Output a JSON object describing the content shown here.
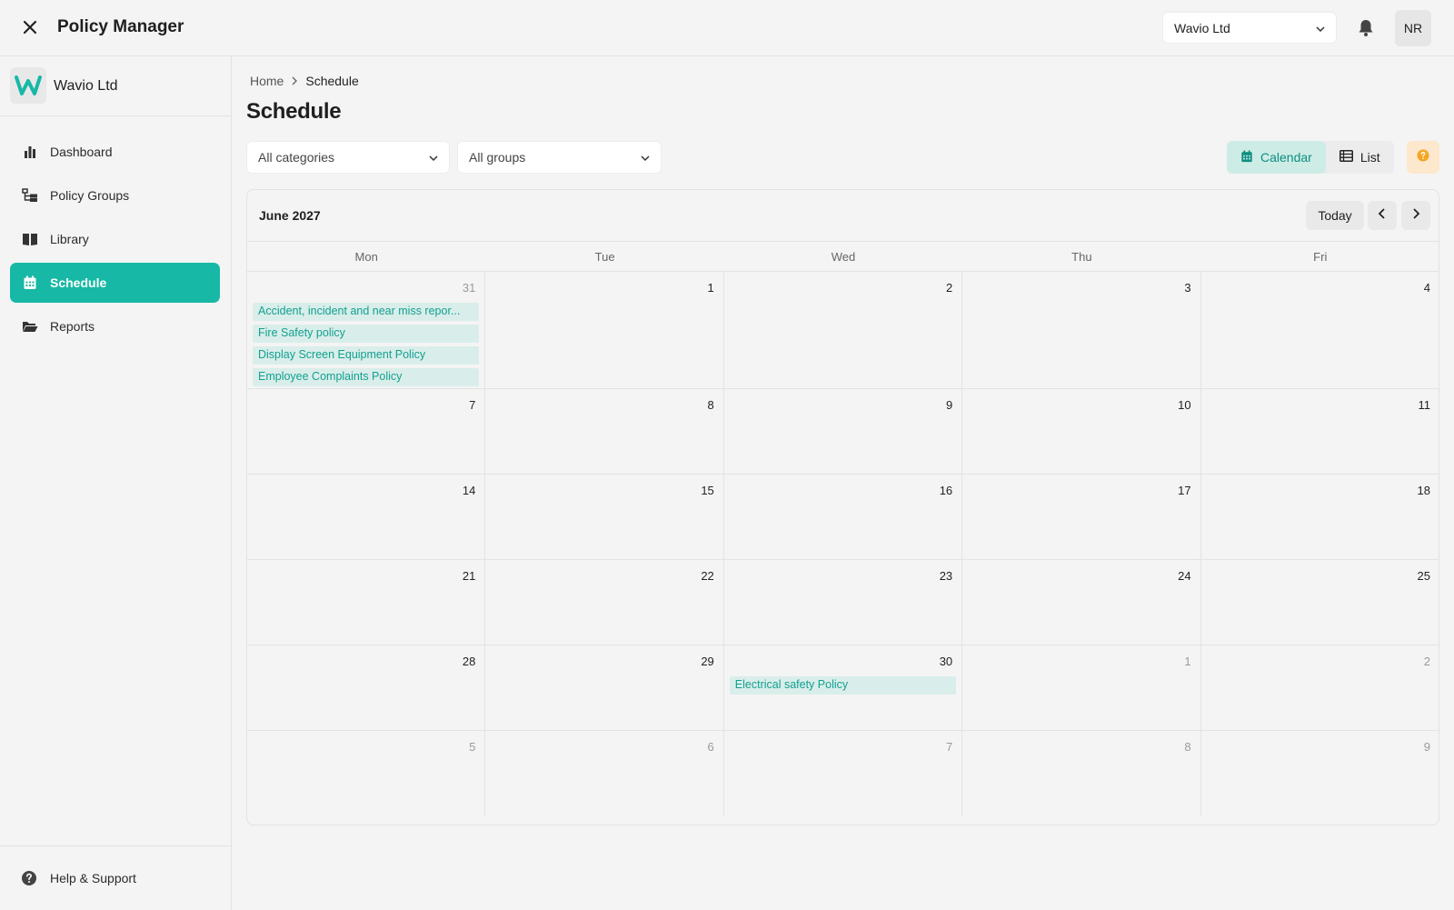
{
  "app": {
    "title": "Policy Manager"
  },
  "header": {
    "org_select": "Wavio Ltd",
    "avatar_initials": "NR"
  },
  "sidebar": {
    "org_name": "Wavio Ltd",
    "items": [
      {
        "label": "Dashboard",
        "icon": "bar-chart-icon"
      },
      {
        "label": "Policy Groups",
        "icon": "hierarchy-icon"
      },
      {
        "label": "Library",
        "icon": "book-icon"
      },
      {
        "label": "Schedule",
        "icon": "calendar-icon",
        "active": true
      },
      {
        "label": "Reports",
        "icon": "folder-icon"
      }
    ],
    "help_label": "Help & Support"
  },
  "breadcrumb": {
    "home": "Home",
    "current": "Schedule"
  },
  "page": {
    "title": "Schedule"
  },
  "filters": {
    "categories": "All categories",
    "groups": "All groups"
  },
  "view_toggle": {
    "calendar": "Calendar",
    "list": "List",
    "active": "Calendar"
  },
  "calendar": {
    "month_label": "June 2027",
    "today_label": "Today",
    "weekdays": [
      "Mon",
      "Tue",
      "Wed",
      "Thu",
      "Fri"
    ],
    "weeks": [
      [
        {
          "day": "31",
          "muted": true,
          "events": [
            "Accident, incident and near miss repor...",
            "Fire Safety policy",
            "Display Screen Equipment Policy",
            "Employee Complaints Policy"
          ]
        },
        {
          "day": "1"
        },
        {
          "day": "2"
        },
        {
          "day": "3"
        },
        {
          "day": "4"
        }
      ],
      [
        {
          "day": "7"
        },
        {
          "day": "8"
        },
        {
          "day": "9"
        },
        {
          "day": "10"
        },
        {
          "day": "11"
        }
      ],
      [
        {
          "day": "14"
        },
        {
          "day": "15"
        },
        {
          "day": "16"
        },
        {
          "day": "17"
        },
        {
          "day": "18"
        }
      ],
      [
        {
          "day": "21"
        },
        {
          "day": "22"
        },
        {
          "day": "23"
        },
        {
          "day": "24"
        },
        {
          "day": "25"
        }
      ],
      [
        {
          "day": "28"
        },
        {
          "day": "29"
        },
        {
          "day": "30",
          "events": [
            "Electrical safety Policy"
          ]
        },
        {
          "day": "1",
          "muted": true
        },
        {
          "day": "2",
          "muted": true
        }
      ],
      [
        {
          "day": "5",
          "muted": true
        },
        {
          "day": "6",
          "muted": true
        },
        {
          "day": "7",
          "muted": true
        },
        {
          "day": "8",
          "muted": true
        },
        {
          "day": "9",
          "muted": true
        }
      ]
    ]
  },
  "colors": {
    "accent": "#17b8a6",
    "event_bg": "#d9eeea",
    "event_text": "#12a08f",
    "warning": "#f5a623"
  }
}
